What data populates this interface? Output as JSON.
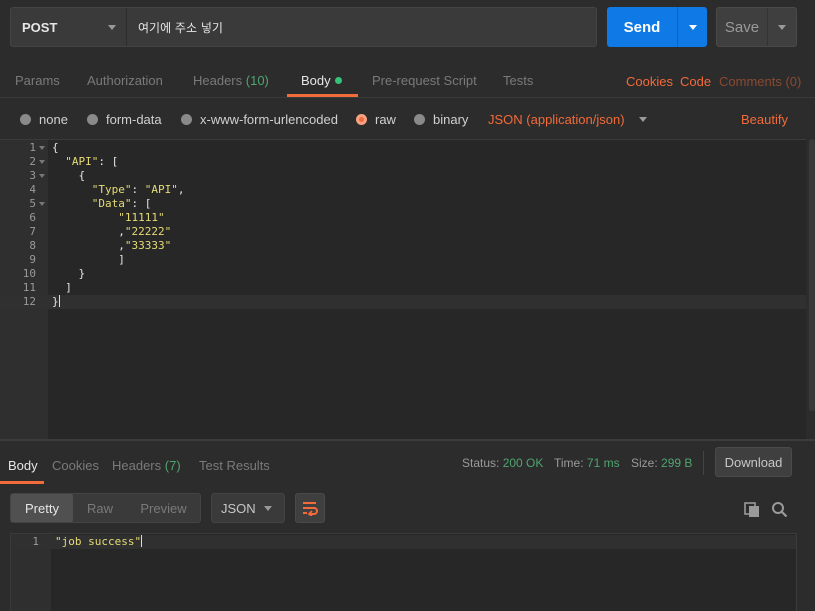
{
  "request": {
    "method": "POST",
    "url": "여기에 주소 넣기",
    "send_label": "Send",
    "save_label": "Save"
  },
  "request_tabs": {
    "params": "Params",
    "authorization": "Authorization",
    "headers": "Headers",
    "headers_count": "(10)",
    "body": "Body",
    "prerequest": "Pre-request Script",
    "tests": "Tests",
    "cookies": "Cookies",
    "code": "Code",
    "comments": "Comments (0)"
  },
  "body_options": {
    "none": "none",
    "form_data": "form-data",
    "urlencoded": "x-www-form-urlencoded",
    "raw": "raw",
    "binary": "binary",
    "selected": "raw",
    "content_type": "JSON (application/json)",
    "beautify": "Beautify"
  },
  "editor": {
    "line_numbers": [
      "1",
      "2",
      "3",
      "4",
      "5",
      "6",
      "7",
      "8",
      "9",
      "10",
      "11",
      "12"
    ],
    "lines": [
      "{",
      "  \"API\": [",
      "    {",
      "      \"Type\": \"API\",",
      "      \"Data\": [",
      "          \"11111\"",
      "          ,\"22222\"",
      "          ,\"33333\"",
      "          ]",
      "    }",
      "  ]",
      "}"
    ]
  },
  "response_tabs": {
    "body": "Body",
    "cookies": "Cookies",
    "headers": "Headers",
    "headers_count": "(7)",
    "test_results": "Test Results"
  },
  "response_status": {
    "status_label": "Status:",
    "status_value": "200 OK",
    "time_label": "Time:",
    "time_value": "71 ms",
    "size_label": "Size:",
    "size_value": "299 B",
    "download": "Download"
  },
  "response_view": {
    "pretty": "Pretty",
    "raw": "Raw",
    "preview": "Preview",
    "format": "JSON",
    "line_number": "1",
    "body": "\"job success\""
  },
  "icons": {
    "wrap": "wrap-lines-icon",
    "copy": "copy-icon",
    "search": "search-icon"
  },
  "colors": {
    "accent": "#f26b3a",
    "send": "#0f7ae5",
    "status_ok": "#4fa56f",
    "background": "#2c2c2c"
  }
}
